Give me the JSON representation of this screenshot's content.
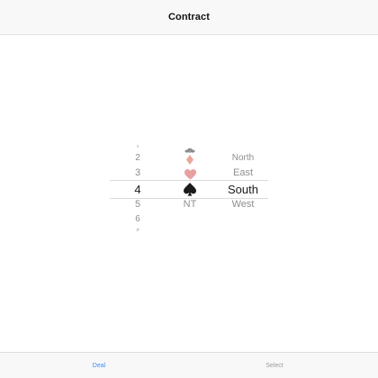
{
  "navbar": {
    "title": "Contract"
  },
  "picker": {
    "levels": [
      "1",
      "2",
      "3",
      "4",
      "5",
      "6",
      "7"
    ],
    "selected_level": "4",
    "suits": [
      {
        "name": "clubs",
        "icon": "clubs-icon",
        "color": "#8c8c8c"
      },
      {
        "name": "diamonds",
        "icon": "diamonds-icon",
        "color": "#e8a898"
      },
      {
        "name": "hearts",
        "icon": "hearts-icon",
        "color": "#e8a0a0"
      },
      {
        "name": "spades",
        "icon": "spades-icon",
        "color": "#1b1b1b"
      },
      {
        "name": "no-trump",
        "label": "NT",
        "color": "#8e8e8e"
      }
    ],
    "selected_suit": "spades",
    "seats": [
      "North",
      "East",
      "South",
      "West"
    ],
    "selected_seat": "South"
  },
  "tabbar": {
    "deal_label": "Deal",
    "select_label": "Select",
    "active_color": "#3b8ff0",
    "inactive_color": "#9b9b9b"
  }
}
